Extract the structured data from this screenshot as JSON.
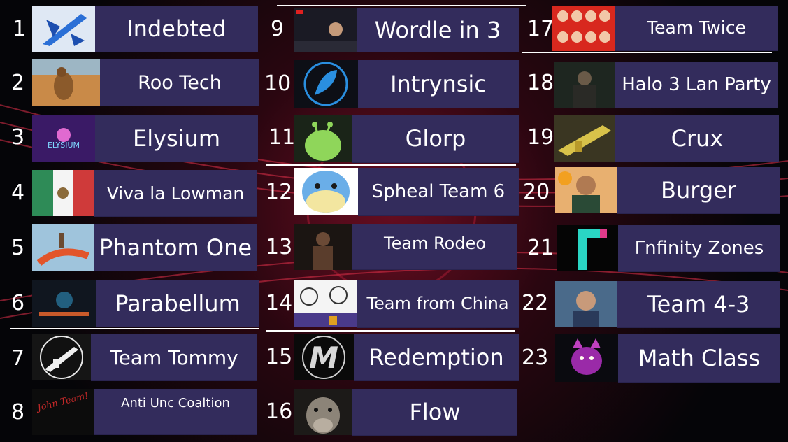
{
  "entries": [
    {
      "num": "1",
      "name": "Indebted",
      "icon": "blue-jet-emblem-icon"
    },
    {
      "num": "2",
      "name": "Roo Tech",
      "icon": "kangaroo-photo-icon"
    },
    {
      "num": "3",
      "name": "Elysium",
      "icon": "elysium-logo-icon"
    },
    {
      "num": "4",
      "name": "Viva la Lowman",
      "icon": "mexico-flag-icon"
    },
    {
      "num": "5",
      "name": "Phantom One",
      "icon": "shrimp-rider-icon"
    },
    {
      "num": "6",
      "name": "Parabellum",
      "icon": "dark-scene-icon"
    },
    {
      "num": "7",
      "name": "Team Tommy",
      "icon": "tommy-gun-icon"
    },
    {
      "num": "8",
      "name": "Anti Unc Coaltion",
      "icon": "handwritten-note-icon",
      "note": "John Team!"
    },
    {
      "num": "9",
      "name": "Wordle in 3",
      "icon": "video-screenshot-icon"
    },
    {
      "num": "10",
      "name": "Intrynsic",
      "icon": "blue-leaf-logo-icon"
    },
    {
      "num": "11",
      "name": "Glorp",
      "icon": "green-alien-cat-icon"
    },
    {
      "num": "12",
      "name": "Spheal Team 6",
      "icon": "spheal-icon"
    },
    {
      "num": "13",
      "name": "Team Rodeo",
      "icon": "rapper-photo-icon"
    },
    {
      "num": "14",
      "name": "Team from China",
      "icon": "meme-collage-icon"
    },
    {
      "num": "15",
      "name": "Redemption",
      "icon": "chrome-m-logo-icon"
    },
    {
      "num": "16",
      "name": "Flow",
      "icon": "donkey-photo-icon"
    },
    {
      "num": "17",
      "name": "Team Twice",
      "icon": "group-photo-grid-icon"
    },
    {
      "num": "18",
      "name": "Halo 3 Lan Party",
      "icon": "movie-still-icon"
    },
    {
      "num": "19",
      "name": "Crux",
      "icon": "gold-blaster-icon"
    },
    {
      "num": "20",
      "name": "Burger",
      "icon": "burger-king-man-icon"
    },
    {
      "num": "21",
      "name": "Γnfinity Zones",
      "icon": "teal-pink-logo-icon"
    },
    {
      "num": "22",
      "name": "Team 4-3",
      "icon": "streamer-photo-icon"
    },
    {
      "num": "23",
      "name": "Math Class",
      "icon": "purple-devil-cat-icon"
    }
  ],
  "colors": {
    "panel": "#332c5c",
    "background": "#07070c",
    "accent_red": "#b3142e",
    "text": "#ffffff"
  }
}
